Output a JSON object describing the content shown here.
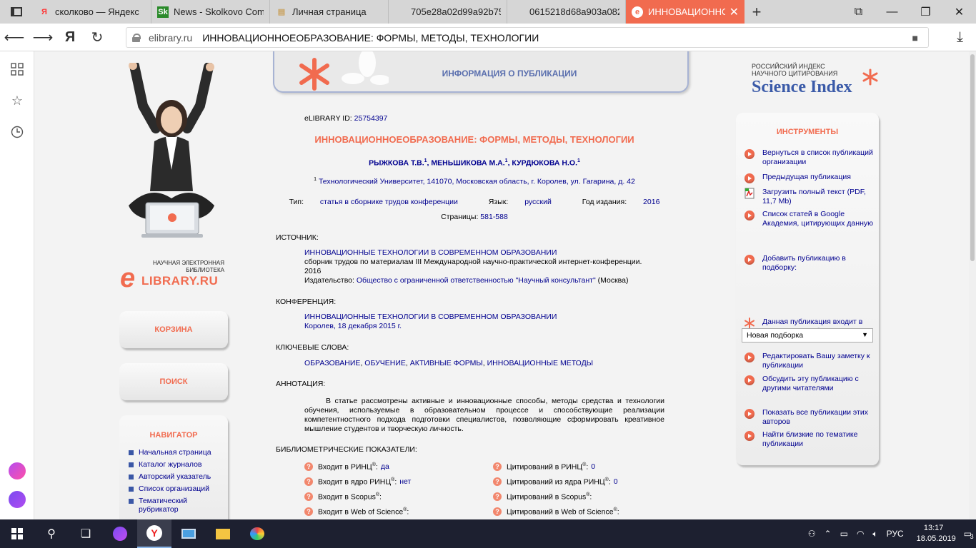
{
  "browser": {
    "tabs": [
      {
        "label": "сколково — Яндекс",
        "icon": "yandex-icon",
        "icon_glyph": "Я",
        "icon_color": "#f33"
      },
      {
        "label": "News - Skolkovo Com",
        "icon": "skolkovo-icon",
        "icon_glyph": "Sk",
        "icon_color": "#2a2"
      },
      {
        "label": "Личная страница",
        "icon": "page-icon",
        "icon_glyph": "▤",
        "icon_color": "#c9a25f"
      },
      {
        "label": "705e28a02d99a92b75",
        "icon": "",
        "icon_glyph": "",
        "icon_color": ""
      },
      {
        "label": "0615218d68a903a082",
        "icon": "",
        "icon_glyph": "",
        "icon_color": ""
      },
      {
        "label": "ИННОВАЦИОННОЕ",
        "icon": "elibrary-icon",
        "icon_glyph": "e",
        "icon_color": "#fff",
        "active": true
      }
    ],
    "address": {
      "domain": "elibrary.ru",
      "title": "ИННОВАЦИОННОЕОБРАЗОВАНИЕ: ФОРМЫ, МЕТОДЫ, ТЕХНОЛОГИИ",
      "ya_label": "Я"
    }
  },
  "sidebar": {
    "logo_small": "НАУЧНАЯ ЭЛЕКТРОННАЯ БИБЛИОТЕКА",
    "logo_e": "e",
    "logo_text": "LIBRARY.RU",
    "cart_label": "КОРЗИНА",
    "search_label": "ПОИСК",
    "nav_title": "НАВИГАТОР",
    "nav_items": [
      "Начальная страница",
      "Каталог журналов",
      "Авторский указатель",
      "Список организаций",
      "Тематический рубрикатор"
    ]
  },
  "header": {
    "title": "ИНФОРМАЦИЯ О ПУБЛИКАЦИИ"
  },
  "publication": {
    "id_label": "eLIBRARY ID:",
    "id_value": "25754397",
    "title": "ИННОВАЦИОННОЕОБРАЗОВАНИЕ: ФОРМЫ, МЕТОДЫ, ТЕХНОЛОГИИ",
    "authors": [
      "РЫЖКОВА Т.В.",
      "МЕНЬШИКОВА М.А.",
      "КУРДЮКОВА Н.О."
    ],
    "affil_sup": "1",
    "affiliation": "Технологический Университет, 141070, Московская область, г. Королев, ул. Гагарина, д. 42",
    "type_label": "Тип:",
    "type_value": "статья в сборнике трудов конференции",
    "lang_label": "Язык:",
    "lang_value": "русский",
    "year_label": "Год издания:",
    "year_value": "2016",
    "pages_label": "Страницы:",
    "pages_value": "581-588",
    "source_label": "ИСТОЧНИК:",
    "source_title": "ИННОВАЦИОННЫЕ ТЕХНОЛОГИИ В СОВРЕМЕННОМ ОБРАЗОВАНИИ",
    "source_desc": "сборник трудов по материалам III Международной научно-практической интернет-конференции.",
    "source_year": "2016",
    "publisher_label": "Издательство:",
    "publisher_value": "Общество с ограниченной ответственностью \"Научный консультант\"",
    "publisher_city": "(Москва)",
    "conf_label": "КОНФЕРЕНЦИЯ:",
    "conf_title": "ИННОВАЦИОННЫЕ ТЕХНОЛОГИИ В СОВРЕМЕННОМ ОБРАЗОВАНИИ",
    "conf_place": "Королев, 18 декабря 2015 г.",
    "kw_label": "КЛЮЧЕВЫЕ СЛОВА:",
    "keywords": [
      "ОБРАЗОВАНИЕ",
      "ОБУЧЕНИЕ",
      "АКТИВНЫЕ ФОРМЫ",
      "ИННОВАЦИОННЫЕ МЕТОДЫ"
    ],
    "abstract_label": "АННОТАЦИЯ:",
    "abstract": "В статье рассмотрены активные и инновационные способы, методы средства и технологии обучения, используемые в образовательном процессе и способствующие реализации компетентностного подхода подготовки специалистов, позволяющие сформировать креативное мышление студентов и творческую личность.",
    "bibl_label": "БИБЛИОМЕТРИЧЕСКИЕ ПОКАЗАТЕЛИ:",
    "bibl_left": [
      {
        "label": "Входит в РИНЦ",
        "value": "да"
      },
      {
        "label": "Входит в ядро РИНЦ",
        "value": "нет"
      },
      {
        "label": "Входит в Scopus",
        "value": ""
      },
      {
        "label": "Входит в Web of Science",
        "value": ""
      }
    ],
    "bibl_right": [
      {
        "label": "Цитирований в РИНЦ",
        "value": "0"
      },
      {
        "label": "Цитирований из ядра РИНЦ",
        "value": "0"
      },
      {
        "label": "Цитирований в Scopus",
        "value": ""
      },
      {
        "label": "Цитирований в Web of Science",
        "value": ""
      }
    ],
    "reg": "®"
  },
  "science_index": {
    "line1": "РОССИЙСКИЙ ИНДЕКС",
    "line2": "НАУЧНОГО ЦИТИРОВАНИЯ",
    "big": "Science Index"
  },
  "tools": {
    "title": "ИНСТРУМЕНТЫ",
    "items": [
      "Вернуться в список публикаций организации",
      "Предыдущая публикация",
      "Загрузить полный текст (PDF, 11,7 Mb)",
      "Список статей в Google Академия, цитирующих данную",
      "Добавить публикацию в подборку:",
      "Данная публикация входит в список моих работ",
      "Редактировать Вашу заметку к публикации",
      "Обсудить эту публикацию с другими читателями",
      "Показать все публикации этих авторов",
      "Найти близкие по тематике публикации"
    ],
    "select_value": "Новая подборка"
  },
  "taskbar": {
    "lang": "РУС",
    "time": "13:17",
    "date": "18.05.2019",
    "notif_count": "3"
  },
  "colors": {
    "accent": "#f16b4f",
    "link": "#00008f",
    "header_blue": "#5a6fae"
  }
}
